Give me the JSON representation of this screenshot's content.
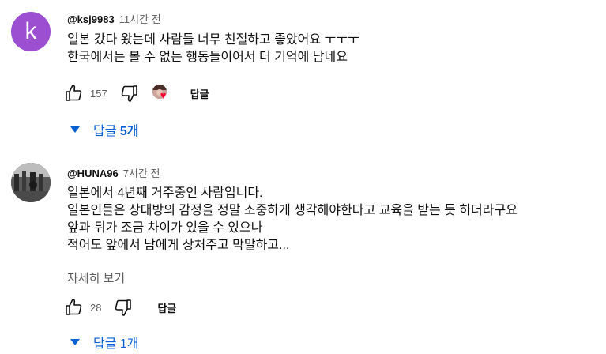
{
  "comments": [
    {
      "author": "@ksj9983",
      "time": "11시간 전",
      "avatar_letter": "k",
      "lines": [
        "일본 갔다 왔는데 사람들 너무 친절하고 좋았어요 ㅜㅜㅜ",
        "한국에서는 볼 수 없는 행동들이어서 더 기억에 남네요"
      ],
      "likes": "157",
      "reply_label": "답글",
      "replies_prefix": "답글 ",
      "replies_count": "5개"
    },
    {
      "author": "@HUNA96",
      "time": "7시간 전",
      "lines": [
        "일본에서 4년째 거주중인 사람입니다.",
        "일본인들은 상대방의 감정을 정말 소중하게 생각해야한다고 교육을 받는 듯 하더라구요",
        "앞과 뒤가 조금 차이가 있을 수 있으나",
        "적어도 앞에서 남에게 상처주고 막말하고..."
      ],
      "read_more": "자세히 보기",
      "likes": "28",
      "reply_label": "답글",
      "replies_text": "답글 1개"
    }
  ],
  "colors": {
    "accent": "#065fd4",
    "avatar_k": "#9c4fd0",
    "heart": "#ff0033"
  }
}
